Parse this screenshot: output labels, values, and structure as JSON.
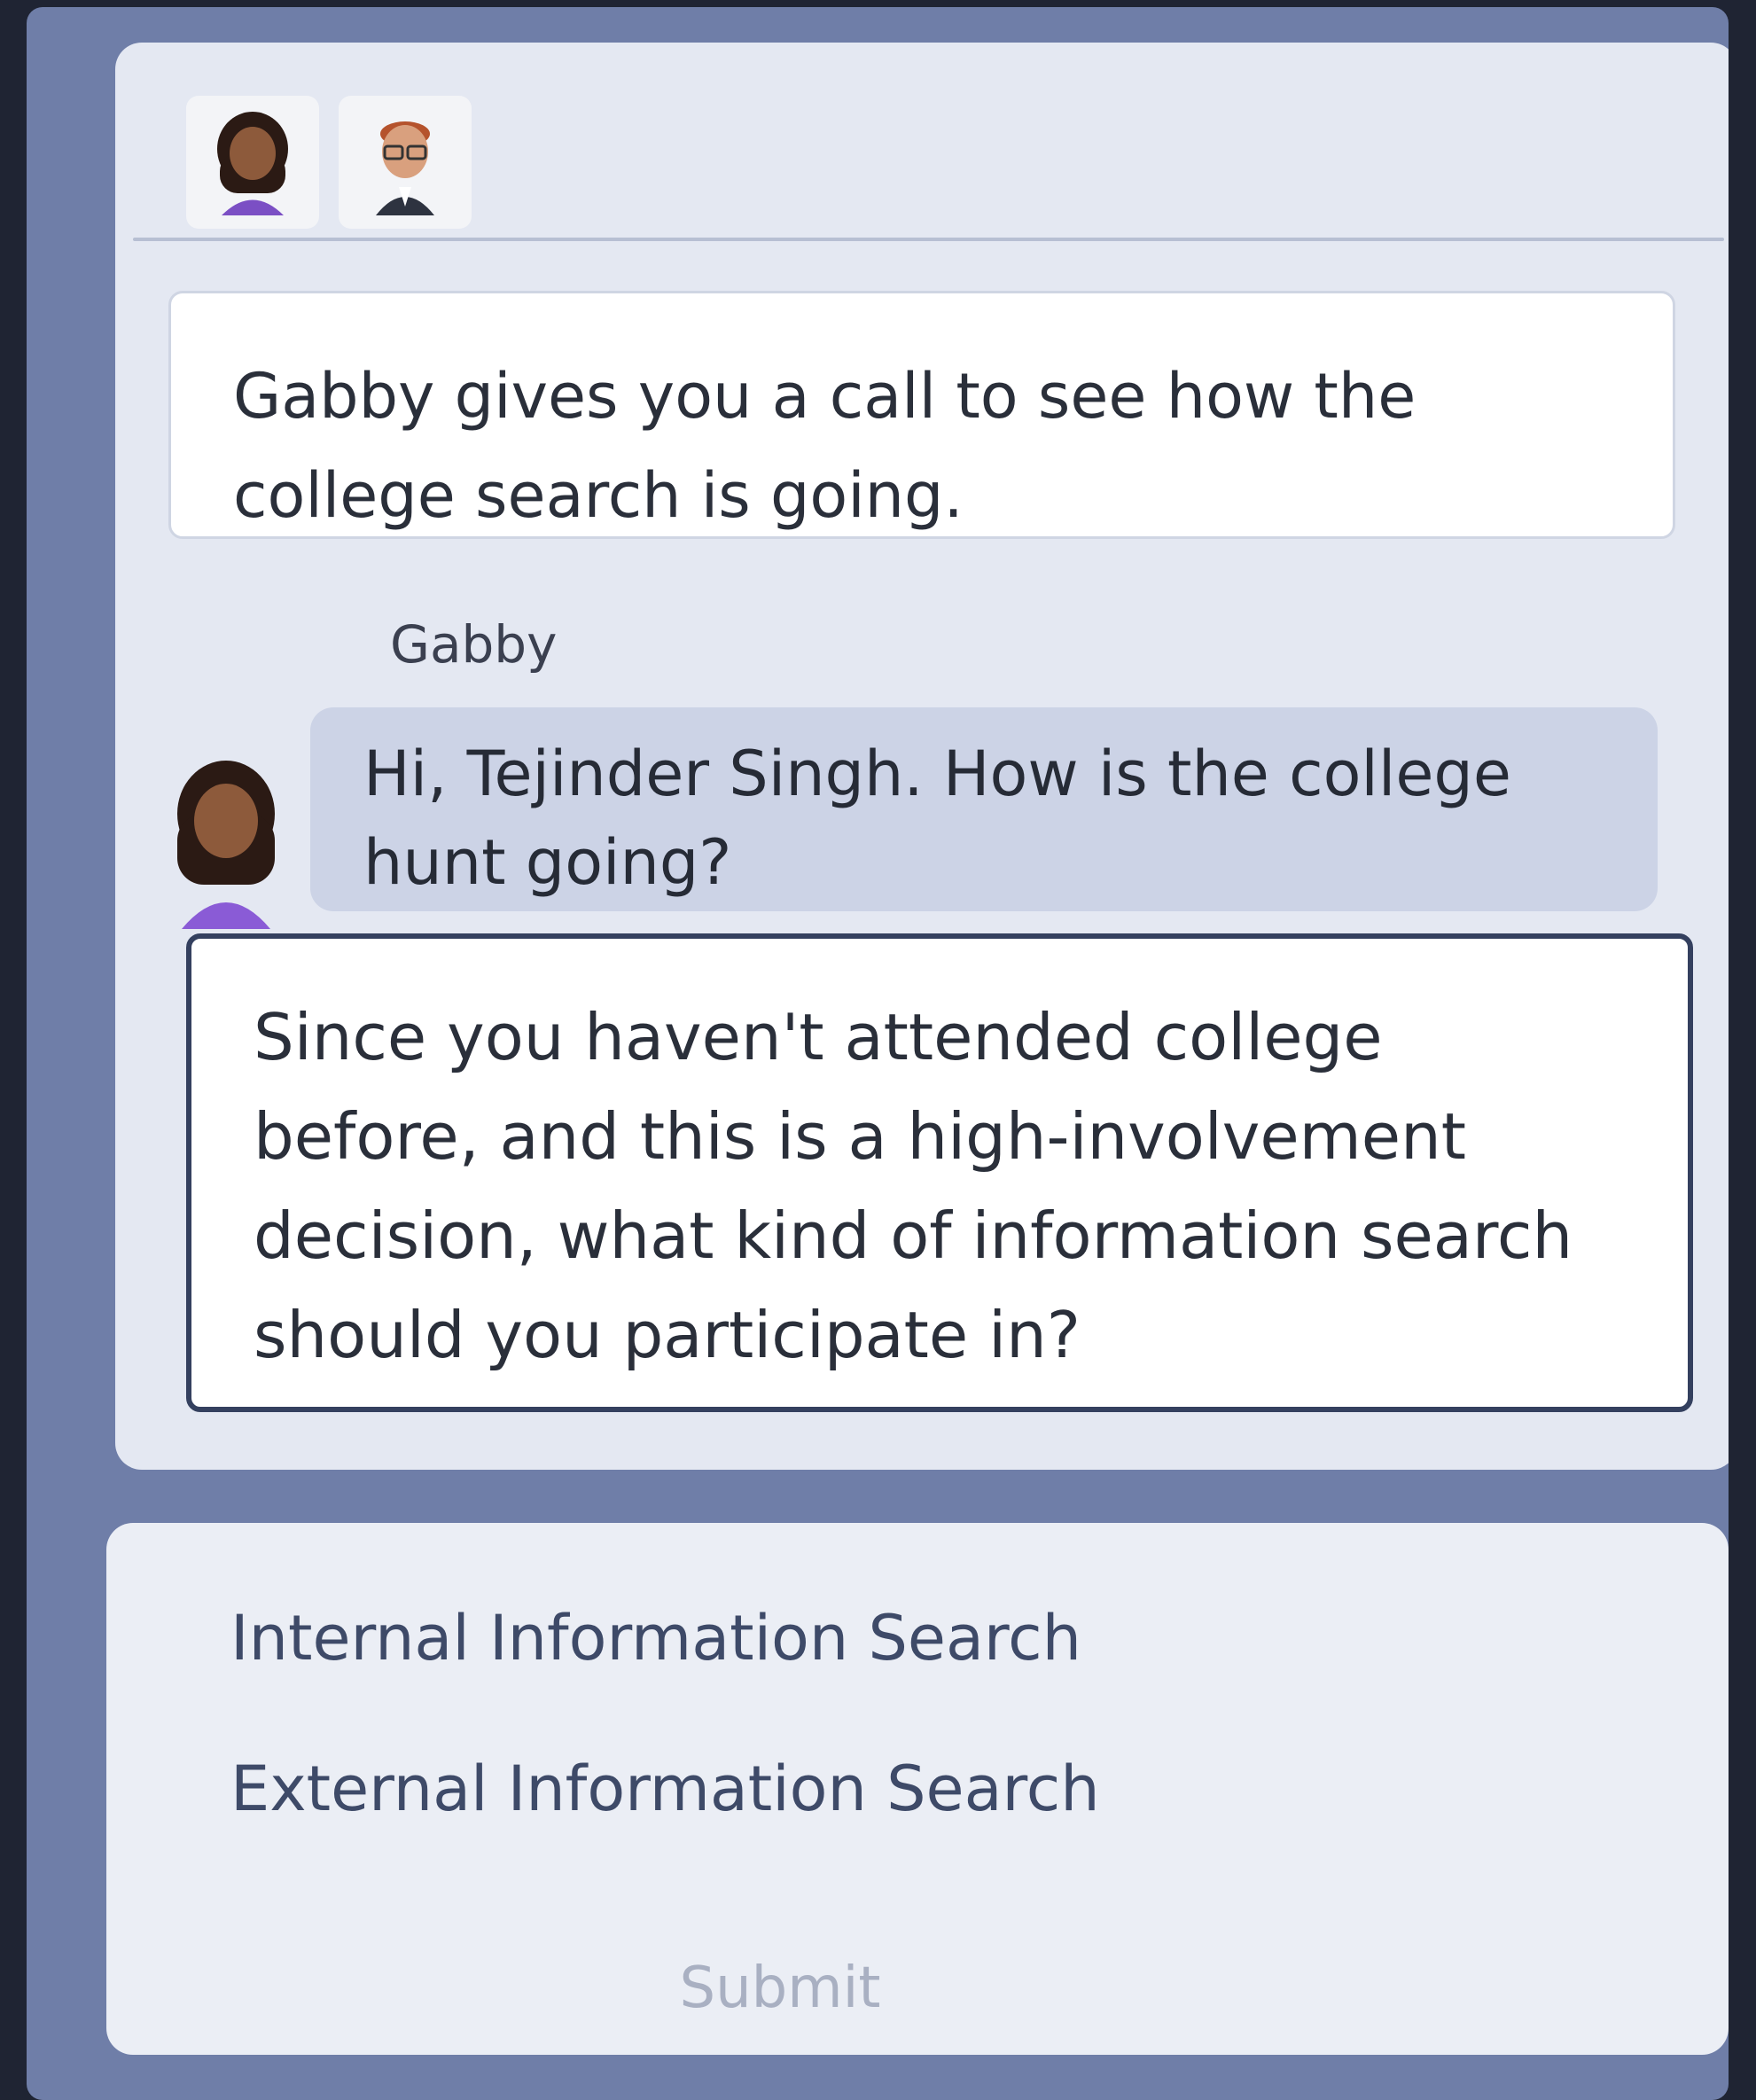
{
  "dialogue": {
    "participants": [
      {
        "name": "Gabby",
        "avatar": "woman-avatar-icon"
      },
      {
        "name": "Tejinder Singh",
        "avatar": "man-with-glasses-avatar-icon"
      }
    ],
    "narration": "Gabby gives you a call to see how the college search is going.",
    "message": {
      "speaker": "Gabby",
      "text": "Hi, Tejinder Singh. How is the college hunt going?"
    },
    "question": "Since you haven't attended college before, and this is a high-involvement decision, what kind of information search should you participate in?"
  },
  "answers": {
    "options": [
      "Internal Information Search",
      "External Information Search"
    ],
    "submit_label": "Submit"
  },
  "colors": {
    "background": "#6f7ea8",
    "panel": "#e4e8f2",
    "bubble": "#ccd3e6",
    "question_border": "#34405f",
    "option_text": "#3e4a68",
    "submit_disabled": "#a9b0c2"
  }
}
